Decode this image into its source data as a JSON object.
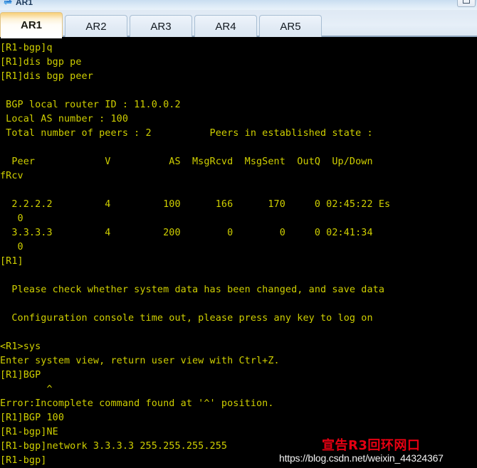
{
  "window": {
    "title": "AR1",
    "icon": "router-icon",
    "restore_button_label": "",
    "restore_icon": "restore-window-icon"
  },
  "tabs": [
    {
      "label": "AR1",
      "active": true
    },
    {
      "label": "AR2",
      "active": false
    },
    {
      "label": "AR3",
      "active": false
    },
    {
      "label": "AR4",
      "active": false
    },
    {
      "label": "AR5",
      "active": false
    }
  ],
  "terminal": {
    "foreground_color": "#cfcf00",
    "background_color": "#000000",
    "lines": [
      "[R1-bgp]q",
      "[R1]dis bgp pe",
      "[R1]dis bgp peer",
      "",
      " BGP local router ID : 11.0.0.2",
      " Local AS number : 100",
      " Total number of peers : 2          Peers in established state :",
      "",
      "  Peer            V          AS  MsgRcvd  MsgSent  OutQ  Up/Down",
      "fRcv",
      "",
      "  2.2.2.2         4         100      166      170     0 02:45:22 Es",
      "   0",
      "  3.3.3.3         4         200        0        0     0 02:41:34",
      "   0",
      "[R1]",
      "",
      "  Please check whether system data has been changed, and save data",
      "",
      "  Configuration console time out, please press any key to log on",
      "",
      "<R1>sys",
      "Enter system view, return user view with Ctrl+Z.",
      "[R1]BGP",
      "        ^",
      "Error:Incomplete command found at '^' position.",
      "[R1]BGP 100",
      "[R1-bgp]NE",
      "[R1-bgp]network 3.3.3.3 255.255.255.255",
      "[R1-bgp]"
    ]
  },
  "watermarks": {
    "url": "https://blog.csdn.net/weixin_44324367",
    "annotation": "宣告R3回环网口",
    "annotation_color": "#e60012"
  }
}
